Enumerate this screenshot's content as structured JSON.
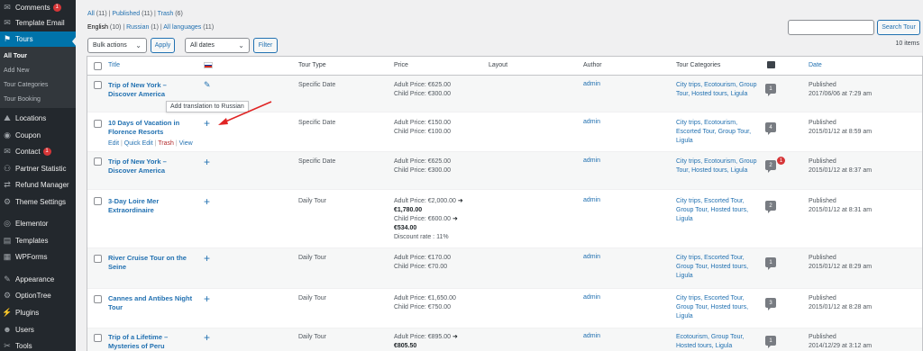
{
  "sidebar": {
    "items": [
      {
        "label": "Comments",
        "badge": "1",
        "icon": "comments-icon",
        "glyph": "✉"
      },
      {
        "label": "Template Email",
        "icon": "email-icon",
        "glyph": "✉"
      },
      {
        "label": "Tours",
        "icon": "tours-icon",
        "glyph": "⚑",
        "active": true
      },
      {
        "label": "Locations",
        "icon": "locations-icon",
        "glyph": "⛰"
      },
      {
        "label": "Coupon",
        "icon": "coupon-icon",
        "glyph": "◉"
      },
      {
        "label": "Contact",
        "badge": "1",
        "icon": "contact-icon",
        "glyph": "✉"
      },
      {
        "label": "Partner Statistic",
        "icon": "partner-statistic-icon",
        "glyph": "⚇"
      },
      {
        "label": "Refund Manager",
        "icon": "refund-manager-icon",
        "glyph": "⇄"
      },
      {
        "label": "Theme Settings",
        "icon": "theme-settings-icon",
        "glyph": "⚙"
      },
      {
        "label": "Elementor",
        "icon": "elementor-icon",
        "glyph": "◎"
      },
      {
        "label": "Templates",
        "icon": "templates-icon",
        "glyph": "▤"
      },
      {
        "label": "WPForms",
        "icon": "wpforms-icon",
        "glyph": "▦"
      },
      {
        "label": "Appearance",
        "icon": "appearance-icon",
        "glyph": "✎"
      },
      {
        "label": "OptionTree",
        "icon": "optiontree-icon",
        "glyph": "⚙"
      },
      {
        "label": "Plugins",
        "icon": "plugins-icon",
        "glyph": "⚡"
      },
      {
        "label": "Users",
        "icon": "users-icon",
        "glyph": "☻"
      },
      {
        "label": "Tools",
        "icon": "tools-icon",
        "glyph": "✂"
      }
    ],
    "submenu": [
      "All Tour",
      "Add New",
      "Tour Categories",
      "Tour Booking"
    ]
  },
  "filters": {
    "status": {
      "all": "All",
      "all_count": "(11)",
      "published": "Published",
      "published_count": "(11)",
      "trash": "Trash",
      "trash_count": "(6)"
    },
    "languages": {
      "english": "English",
      "english_count": "(10)",
      "russian": "Russian",
      "russian_count": "(1)",
      "all": "All languages",
      "all_count": "(11)"
    },
    "bulk_actions": "Bulk actions",
    "apply": "Apply",
    "all_dates": "All dates",
    "filter": "Filter",
    "search_button": "Search Tour",
    "items_count": "10 items"
  },
  "table": {
    "headers": {
      "title": "Title",
      "tour_type": "Tour Type",
      "price": "Price",
      "layout": "Layout",
      "author": "Author",
      "tour_categories": "Tour Categories",
      "date": "Date"
    },
    "flag_colors": [
      "#ffffff",
      "#0039a6",
      "#d52b1e"
    ],
    "tooltip": "Add translation to Russian",
    "row_actions": {
      "edit": "Edit",
      "quick_edit": "Quick Edit",
      "trash": "Trash",
      "view": "View"
    },
    "rows": [
      {
        "title": [
          "Trip of New York –",
          "Discover America"
        ],
        "type": "Specific Date",
        "price": [
          "Adult Price: €625.00",
          "Child Price: €300.00"
        ],
        "author": "admin",
        "cats": [
          "City trips, Ecotourism, Group",
          "Tour, Hosted tours, Ligula"
        ],
        "comments": "1",
        "date": [
          "Published",
          "2017/06/06 at 7:29 am"
        ]
      },
      {
        "title": [
          "10 Days of Vacation in",
          "Florence Resorts"
        ],
        "type": "Specific Date",
        "price": [
          "Adult Price: €150.00",
          "Child Price: €100.00"
        ],
        "author": "admin",
        "cats": [
          "City trips, Ecotourism,",
          "Escorted Tour, Group Tour,",
          "Ligula"
        ],
        "comments": "4",
        "date": [
          "Published",
          "2015/01/12 at 8:59 am"
        ]
      },
      {
        "title": [
          "Trip of New York –",
          "Discover America"
        ],
        "type": "Specific Date",
        "price": [
          "Adult Price: €625.00",
          "Child Price: €300.00"
        ],
        "author": "admin",
        "cats": [
          "City trips, Ecotourism, Group",
          "Tour, Hosted tours, Ligula"
        ],
        "comments": "2",
        "pending": "1",
        "date": [
          "Published",
          "2015/01/12 at 8:37 am"
        ]
      },
      {
        "title": [
          "3-Day Loire Mer",
          "Extraordinaire"
        ],
        "type": "Daily Tour",
        "price": [
          "Adult Price: €2,000.00",
          "€1,780.00",
          "Child Price: €600.00",
          "€534.00",
          "Discount rate : 11%"
        ],
        "author": "admin",
        "cats": [
          "City trips, Escorted Tour,",
          "Group Tour, Hosted tours,",
          "Ligula"
        ],
        "comments": "2",
        "date": [
          "Published",
          "2015/01/12 at 8:31 am"
        ]
      },
      {
        "title": [
          "River Cruise Tour on the",
          "Seine"
        ],
        "type": "Daily Tour",
        "price": [
          "Adult Price: €170.00",
          "Child Price: €70.00"
        ],
        "author": "admin",
        "cats": [
          "City trips, Escorted Tour,",
          "Group Tour, Hosted tours,",
          "Ligula"
        ],
        "comments": "1",
        "date": [
          "Published",
          "2015/01/12 at 8:29 am"
        ]
      },
      {
        "title": [
          "Cannes and Antibes Night",
          "Tour"
        ],
        "type": "Daily Tour",
        "price": [
          "Adult Price: €1,650.00",
          "Child Price: €750.00"
        ],
        "author": "admin",
        "cats": [
          "City trips, Escorted Tour,",
          "Group Tour, Hosted tours,",
          "Ligula"
        ],
        "comments": "3",
        "date": [
          "Published",
          "2015/01/12 at 8:28 am"
        ]
      },
      {
        "title": [
          "Trip of a Lifetime –",
          "Mysteries of Peru"
        ],
        "type": "Daily Tour",
        "price": [
          "Adult Price: €895.00",
          "€805.50"
        ],
        "author": "admin",
        "cats": [
          "Ecotourism, Group Tour,",
          "Hosted tours, Ligula"
        ],
        "comments": "1",
        "date": [
          "Published",
          "2014/12/29 at 3:12 am"
        ]
      }
    ]
  }
}
